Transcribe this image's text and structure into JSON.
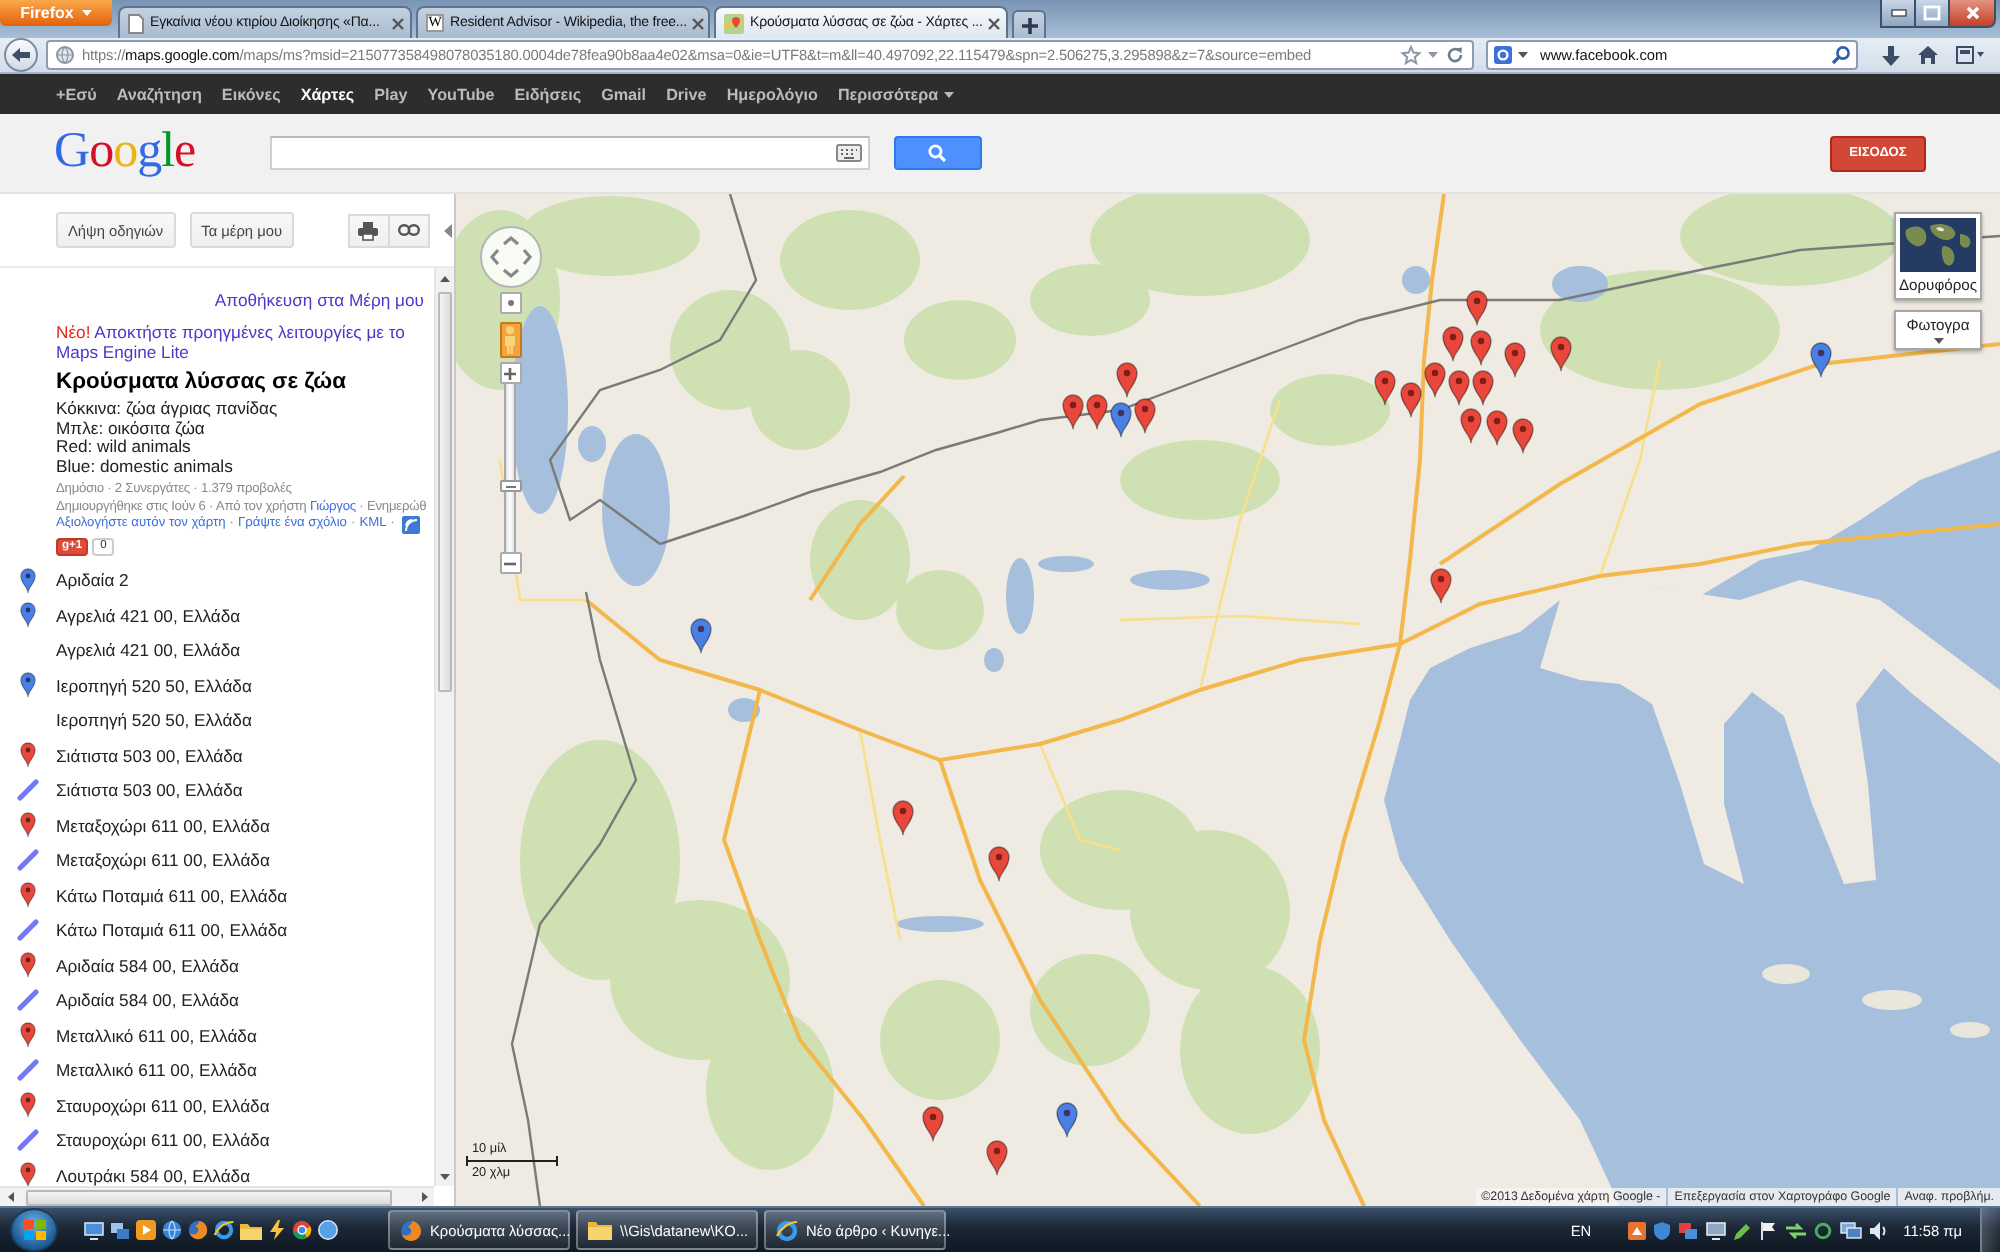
{
  "browser": {
    "menu_button": "Firefox",
    "tabs": [
      {
        "label": "Εγκαίνια νέου κτιρίου Διοίκησης «Πα...",
        "kind": "page",
        "selected": false
      },
      {
        "label": "Resident Advisor - Wikipedia, the free...",
        "kind": "letter",
        "icon_text": "W",
        "selected": false
      },
      {
        "label": "Κρούσματα λύσσας σε ζώα - Χάρτες ...",
        "kind": "map",
        "selected": true
      }
    ],
    "address": {
      "scheme": "https://",
      "domain": "maps.google.com",
      "path": "/maps/ms?msid=215077358498078035180.0004de78fea90b8aa4e02&msa=0&ie=UTF8&t=m&ll=40.497092,22.115479&spn=2.506275,3.295898&z=7&source=embed"
    },
    "search": {
      "value": "www.facebook.com"
    }
  },
  "google_bar": {
    "items": [
      {
        "label": "+Εσύ",
        "selected": false,
        "menu": false
      },
      {
        "label": "Αναζήτηση",
        "selected": false,
        "menu": false
      },
      {
        "label": "Εικόνες",
        "selected": false,
        "menu": false
      },
      {
        "label": "Χάρτες",
        "selected": true,
        "menu": false
      },
      {
        "label": "Play",
        "selected": false,
        "menu": false
      },
      {
        "label": "YouTube",
        "selected": false,
        "menu": false
      },
      {
        "label": "Ειδήσεις",
        "selected": false,
        "menu": false
      },
      {
        "label": "Gmail",
        "selected": false,
        "menu": false
      },
      {
        "label": "Drive",
        "selected": false,
        "menu": false
      },
      {
        "label": "Ημερολόγιο",
        "selected": false,
        "menu": false
      },
      {
        "label": "Περισσότερα",
        "selected": false,
        "menu": true
      }
    ]
  },
  "header": {
    "logo": "Google",
    "sign_in": "ΕΙΣΟΔΟΣ"
  },
  "sidebar": {
    "buttons": [
      "Λήψη οδηγιών",
      "Τα μέρη μου"
    ],
    "save_link": "Αποθήκευση στα Μέρη μου",
    "promo": {
      "badge": "Νέο!",
      "link": "Αποκτήστε προηγμένες λειτουργίες με το Maps Engine Lite"
    },
    "title": "Κρούσματα λύσσας σε ζώα",
    "description": [
      "Κόκκινα: ζώα άγριας πανίδας",
      "Μπλε: οικόσιτα ζώα",
      "Red: wild animals",
      "Blue: domestic animals"
    ],
    "meta": "Δημόσιο · 2 Συνεργάτες · 1.379 προβολές",
    "created_prefix": "Δημιουργήθηκε στις Ιούν 6 · Από τον χρήστη",
    "author": "Γιώργος",
    "created_suffix": "· Ενημερώθ",
    "actions": [
      {
        "kind": "link",
        "text": "Αξιολογήστε αυτόν τον χάρτη"
      },
      {
        "kind": "separator",
        "text": "·"
      },
      {
        "kind": "link",
        "text": "Γράψτε ένα σχόλιο"
      },
      {
        "kind": "separator",
        "text": "·"
      },
      {
        "kind": "link",
        "text": "KML"
      },
      {
        "kind": "separator",
        "text": "·"
      }
    ],
    "plus_one": {
      "label": "g+1",
      "count": "0"
    },
    "items": [
      {
        "label": "Αριδαία 2",
        "kind": "pin",
        "color": "#4a7fe6"
      },
      {
        "label": "Αγρελιά 421 00, Ελλάδα",
        "kind": "pin",
        "color": "#4a7fe6"
      },
      {
        "label": "Αγρελιά 421 00, Ελλάδα",
        "kind": "plain"
      },
      {
        "label": "Ιεροπηγή 520 50, Ελλάδα",
        "kind": "pin",
        "color": "#4a7fe6"
      },
      {
        "label": "Ιεροπηγή 520 50, Ελλάδα",
        "kind": "plain"
      },
      {
        "label": "Σιάτιστα 503 00, Ελλάδα",
        "kind": "pin",
        "color": "#e8473b"
      },
      {
        "label": "Σιάτιστα 503 00, Ελλάδα",
        "kind": "line",
        "color": "#7479f2"
      },
      {
        "label": "Μεταξοχώρι 611 00, Ελλάδα",
        "kind": "pin",
        "color": "#e8473b"
      },
      {
        "label": "Μεταξοχώρι 611 00, Ελλάδα",
        "kind": "line",
        "color": "#7479f2"
      },
      {
        "label": "Κάτω Ποταμιά 611 00, Ελλάδα",
        "kind": "pin",
        "color": "#e8473b"
      },
      {
        "label": "Κάτω Ποταμιά 611 00, Ελλάδα",
        "kind": "line",
        "color": "#7479f2"
      },
      {
        "label": "Αριδαία 584 00, Ελλάδα",
        "kind": "pin",
        "color": "#e8473b"
      },
      {
        "label": "Αριδαία 584 00, Ελλάδα",
        "kind": "line",
        "color": "#7479f2"
      },
      {
        "label": "Μεταλλικό 611 00, Ελλάδα",
        "kind": "pin",
        "color": "#e8473b"
      },
      {
        "label": "Μεταλλικό 611 00, Ελλάδα",
        "kind": "line",
        "color": "#7479f2"
      },
      {
        "label": "Σταυροχώρι 611 00, Ελλάδα",
        "kind": "pin",
        "color": "#e8473b"
      },
      {
        "label": "Σταυροχώρι 611 00, Ελλάδα",
        "kind": "line",
        "color": "#7479f2"
      },
      {
        "label": "Λουτράκι 584 00, Ελλάδα",
        "kind": "pin",
        "color": "#e8473b"
      }
    ]
  },
  "map": {
    "markers": [
      {
        "color": "#e8473b"
      },
      {
        "color": "#e8473b"
      },
      {
        "color": "#e8473b"
      },
      {
        "color": "#e8473b"
      },
      {
        "color": "#4a7fe6"
      },
      {
        "color": "#e8473b"
      },
      {
        "color": "#e8473b"
      },
      {
        "color": "#e8473b"
      },
      {
        "color": "#e8473b"
      },
      {
        "color": "#e8473b"
      },
      {
        "color": "#e8473b"
      },
      {
        "color": "#e8473b"
      },
      {
        "color": "#e8473b"
      },
      {
        "color": "#e8473b"
      },
      {
        "color": "#e8473b"
      },
      {
        "color": "#e8473b"
      },
      {
        "color": "#e8473b"
      },
      {
        "color": "#e8473b"
      },
      {
        "color": "#4a7fe6"
      },
      {
        "color": "#e8473b"
      },
      {
        "color": "#4a7fe6"
      },
      {
        "color": "#e8473b"
      },
      {
        "color": "#e8473b"
      },
      {
        "color": "#e8473b"
      },
      {
        "color": "#e8473b"
      },
      {
        "color": "#4a7fe6"
      }
    ],
    "zoom": {
      "level": 0.39
    },
    "map_types": [
      "Δορυφόρος",
      "Φωτογρα"
    ],
    "scale": [
      "10 μίλ",
      "20 χλμ"
    ],
    "attribution": [
      "©2013 Δεδομένα χάρτη Google -",
      "Επεξεργασία στον Χαρτογράφο Google",
      "Αναφ. προβλήμ."
    ]
  },
  "taskbar": {
    "tasks": [
      {
        "label": "Κρούσματα λύσσας...",
        "kind": "browser"
      },
      {
        "label": "\\\\Gis\\datanew\\KO...",
        "kind": "folder"
      },
      {
        "label": "Νέο άρθρο ‹ Κυνηγε...",
        "kind": "explorer"
      }
    ],
    "language": "EN",
    "clock": "11:58 πμ"
  }
}
